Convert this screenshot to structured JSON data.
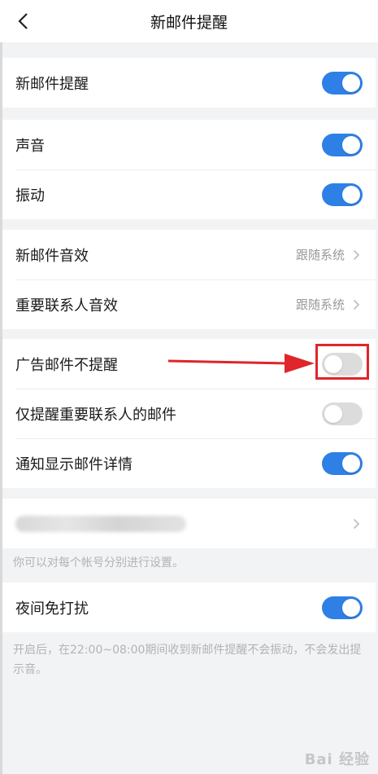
{
  "header": {
    "title": "新邮件提醒"
  },
  "groups": {
    "new_mail": {
      "label": "新邮件提醒",
      "on": true
    },
    "sound": {
      "label": "声音",
      "on": true
    },
    "vibrate": {
      "label": "振动",
      "on": true
    },
    "mail_sound": {
      "label": "新邮件音效",
      "value": "跟随系统"
    },
    "vip_sound": {
      "label": "重要联系人音效",
      "value": "跟随系统"
    },
    "ad_mail": {
      "label": "广告邮件不提醒",
      "on": false
    },
    "vip_only": {
      "label": "仅提醒重要联系人的邮件",
      "on": false
    },
    "show_details": {
      "label": "通知显示邮件详情",
      "on": true
    },
    "account_note": "你可以对每个帐号分别进行设置。",
    "night_mode": {
      "label": "夜间免打扰",
      "on": true
    },
    "night_note": "开启后，在22:00~08:00期间收到新邮件提醒不会振动，不会发出提示音。"
  },
  "watermark": "Bai 经验",
  "colors": {
    "accent": "#2e80e6",
    "annotation": "#e0252b"
  },
  "icons": {
    "back": "chevron-left-icon",
    "row_arrow": "chevron-right-icon"
  }
}
